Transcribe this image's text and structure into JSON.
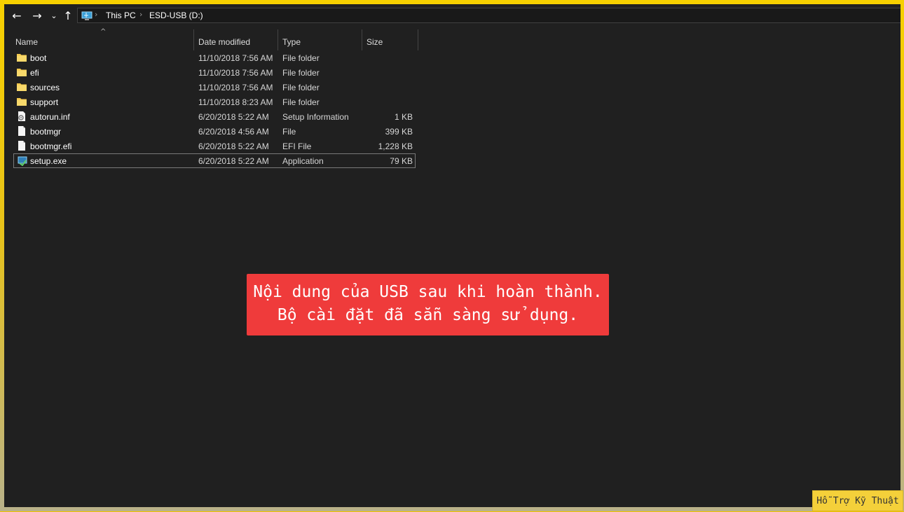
{
  "nav": {
    "back_icon": "arrow-left-icon",
    "forward_icon": "arrow-right-icon",
    "recent_icon": "chevron-down-icon",
    "up_icon": "arrow-up-icon",
    "breadcrumb": [
      "This PC",
      "ESD-USB (D:)"
    ]
  },
  "columns": {
    "name": "Name",
    "date_modified": "Date modified",
    "type": "Type",
    "size": "Size"
  },
  "files": [
    {
      "name": "boot",
      "date": "11/10/2018 7:56 AM",
      "type": "File folder",
      "size": "",
      "icon": "folder-icon"
    },
    {
      "name": "efi",
      "date": "11/10/2018 7:56 AM",
      "type": "File folder",
      "size": "",
      "icon": "folder-icon"
    },
    {
      "name": "sources",
      "date": "11/10/2018 7:56 AM",
      "type": "File folder",
      "size": "",
      "icon": "folder-icon"
    },
    {
      "name": "support",
      "date": "11/10/2018 8:23 AM",
      "type": "File folder",
      "size": "",
      "icon": "folder-icon"
    },
    {
      "name": "autorun.inf",
      "date": "6/20/2018 5:22 AM",
      "type": "Setup Information",
      "size": "1 KB",
      "icon": "setup-info-file-icon"
    },
    {
      "name": "bootmgr",
      "date": "6/20/2018 4:56 AM",
      "type": "File",
      "size": "399 KB",
      "icon": "file-icon"
    },
    {
      "name": "bootmgr.efi",
      "date": "6/20/2018 5:22 AM",
      "type": "EFI File",
      "size": "1,228 KB",
      "icon": "file-icon"
    },
    {
      "name": "setup.exe",
      "date": "6/20/2018 5:22 AM",
      "type": "Application",
      "size": "79 KB",
      "icon": "setup-app-icon"
    }
  ],
  "callout": {
    "line1": "Nội dung của USB sau khi hoàn thành.",
    "line2": "Bộ cài đặt đã sẵn sàng sử dụng."
  },
  "badge": "Hỗ Trợ Kỹ Thuật",
  "colors": {
    "background": "#202020",
    "frame": "#f2c400",
    "callout": "#ef3b3b",
    "badge": "#f4d03a",
    "folder": "#f3c94c"
  }
}
